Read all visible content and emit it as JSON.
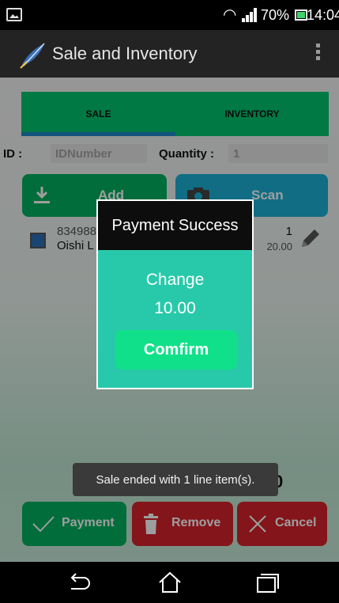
{
  "status_bar": {
    "battery_percent": "70%",
    "time": "14:04"
  },
  "app_bar": {
    "title": "Sale and Inventory"
  },
  "tabs": [
    {
      "label": "SALE",
      "selected": true
    },
    {
      "label": "INVENTORY",
      "selected": false
    }
  ],
  "form": {
    "id_label": "ID :",
    "id_placeholder": "IDNumber",
    "quantity_label": "Quantity :",
    "quantity_value": "1"
  },
  "actions": {
    "add_label": "Add",
    "scan_label": "Scan"
  },
  "line_item": {
    "code": "834988",
    "name": "Oishi L",
    "quantity": "1",
    "price": "20.00"
  },
  "total": "0",
  "toast": "Sale ended with 1 line item(s).",
  "bottom_buttons": {
    "payment": "Payment",
    "remove": "Remove",
    "cancel": "Cancel"
  },
  "dialog": {
    "title": "Payment Success",
    "change_label": "Change",
    "change_value": "10.00",
    "confirm_label": "Comfirm"
  },
  "colors": {
    "accent_green": "#00c36e",
    "scan_blue": "#1ab0d6",
    "danger_red": "#d6232c",
    "dialog_teal": "#28c9aa",
    "tab_indicator": "#1e88c8"
  }
}
